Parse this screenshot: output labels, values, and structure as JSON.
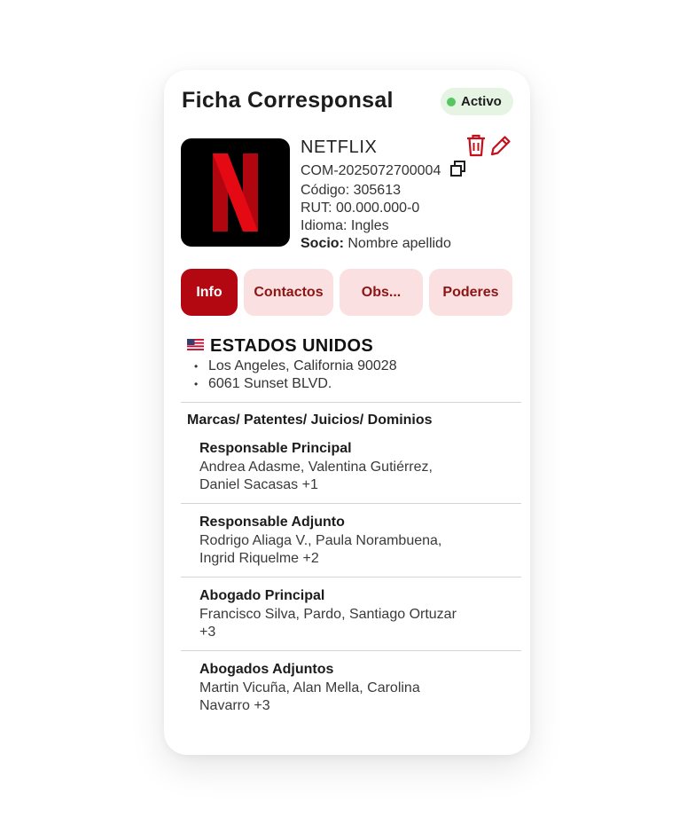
{
  "card": {
    "title": "Ficha Corresponsal",
    "status": "Activo",
    "colors": {
      "accent": "#b30812",
      "status_dot": "#56c563",
      "tab_bg": "#fae0e0"
    }
  },
  "client": {
    "logo_icon": "netflix-n-logo",
    "name": "NETFLIX",
    "id": "COM-2025072700004",
    "code": "Código: 305613",
    "rut": "RUT: 00.000.000-0",
    "language": "Idioma: Ingles",
    "partner_label": "Socio:",
    "partner_name": " Nombre apellido"
  },
  "actions": {
    "delete_icon": "trash-icon",
    "edit_icon": "pencil-icon",
    "copy_icon": "copy-icon"
  },
  "tabs": [
    {
      "label": "Info",
      "active": true
    },
    {
      "label": "Contactos",
      "active": false
    },
    {
      "label": "Obs...",
      "active": false
    },
    {
      "label": "Poderes",
      "active": false
    }
  ],
  "location": {
    "flag_icon": "us-flag-icon",
    "country": "ESTADOS UNIDOS",
    "address": [
      "Los Angeles, California 90028",
      "6061 Sunset BLVD."
    ]
  },
  "section_title": "Marcas/ Patentes/ Juicios/ Dominios",
  "people": [
    {
      "role": "Responsable Principal",
      "names_line1": "Andrea Adasme, Valentina Gutiérrez,",
      "names_line2": "Daniel Sacasas +1"
    },
    {
      "role": "Responsable Adjunto",
      "names_line1": "Rodrigo Aliaga V., Paula Norambuena,",
      "names_line2": "Ingrid Riquelme +2"
    },
    {
      "role": "Abogado Principal",
      "names_line1": "Francisco Silva, Pardo, Santiago Ortuzar",
      "names_line2": "+3"
    },
    {
      "role": "Abogados Adjuntos",
      "names_line1": "Martin Vicuña, Alan Mella, Carolina",
      "names_line2": "Navarro +3"
    }
  ]
}
